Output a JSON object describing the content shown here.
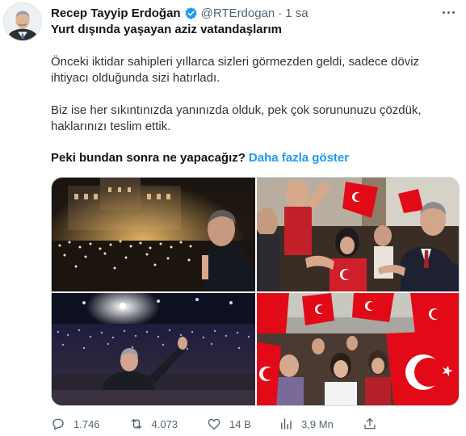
{
  "author": {
    "name": "Recep Tayyip Erdoğan",
    "handle": "@RTErdogan",
    "separator": "·",
    "time": "1 sa"
  },
  "tweet": {
    "title": "Yurt dışında yaşayan aziz vatandaşlarım",
    "paragraph1": [
      "Önceki iktidar sahipleri yıllarca sizleri görmezden geldi, sadece döviz",
      "ihtiyacı olduğunda sizi hatırladı."
    ],
    "paragraph2": [
      "Biz ise her sıkıntınızda yanınızda olduk, pek çok sorununuzu çözdük,",
      "haklarınızı teslim ettik."
    ],
    "question": "Peki bundan sonra ne yapacağız?",
    "show_more": "Daha fazla göster"
  },
  "media": {
    "photos": [
      "night-rally-photo",
      "crowd-greeting-photo",
      "stadium-wave-photo",
      "flags-crowd-photo"
    ]
  },
  "actions": {
    "replies": "1.746",
    "retweets": "4.073",
    "likes": "14 B",
    "views": "3,9 Mn"
  },
  "colors": {
    "accent": "#1d9bf0",
    "verified_badge": "#1d9bf0",
    "flag_red": "#e30a17",
    "muted_text": "#536471"
  }
}
